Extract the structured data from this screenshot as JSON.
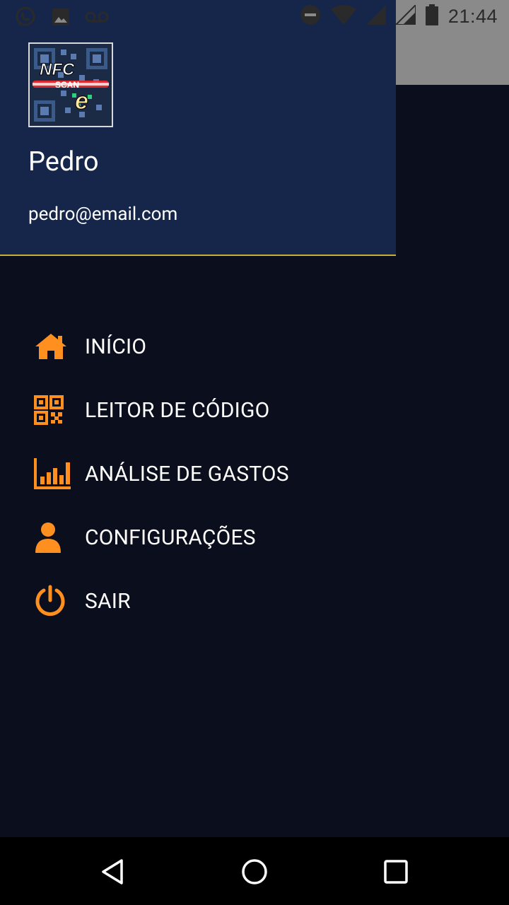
{
  "status_bar": {
    "time": "21:44",
    "left_icons": [
      "whatsapp-icon",
      "image-icon",
      "voicemail-icon"
    ],
    "right_icons": [
      "do-not-disturb-icon",
      "wifi-icon",
      "signal-icon",
      "signal-icon",
      "battery-icon"
    ]
  },
  "drawer": {
    "user": {
      "name": "Pedro",
      "email": "pedro@email.com"
    },
    "logo": {
      "line1": "NFC",
      "line2": "SCAN",
      "line3": "e"
    },
    "menu": [
      {
        "label": "INÍCIO",
        "icon": "home-icon"
      },
      {
        "label": "LEITOR DE CÓDIGO",
        "icon": "qr-code-icon"
      },
      {
        "label": "ANÁLISE DE GASTOS",
        "icon": "bar-chart-icon"
      },
      {
        "label": "CONFIGURAÇÕES",
        "icon": "person-icon"
      },
      {
        "label": "SAIR",
        "icon": "power-icon"
      }
    ]
  },
  "nav_bar": {
    "buttons": [
      "back-icon",
      "home-circle-icon",
      "recents-icon"
    ]
  },
  "colors": {
    "accent": "#ff8f1f",
    "header_bg": "#15264a",
    "drawer_bg": "#0b0e1c",
    "divider": "#c9b038"
  }
}
